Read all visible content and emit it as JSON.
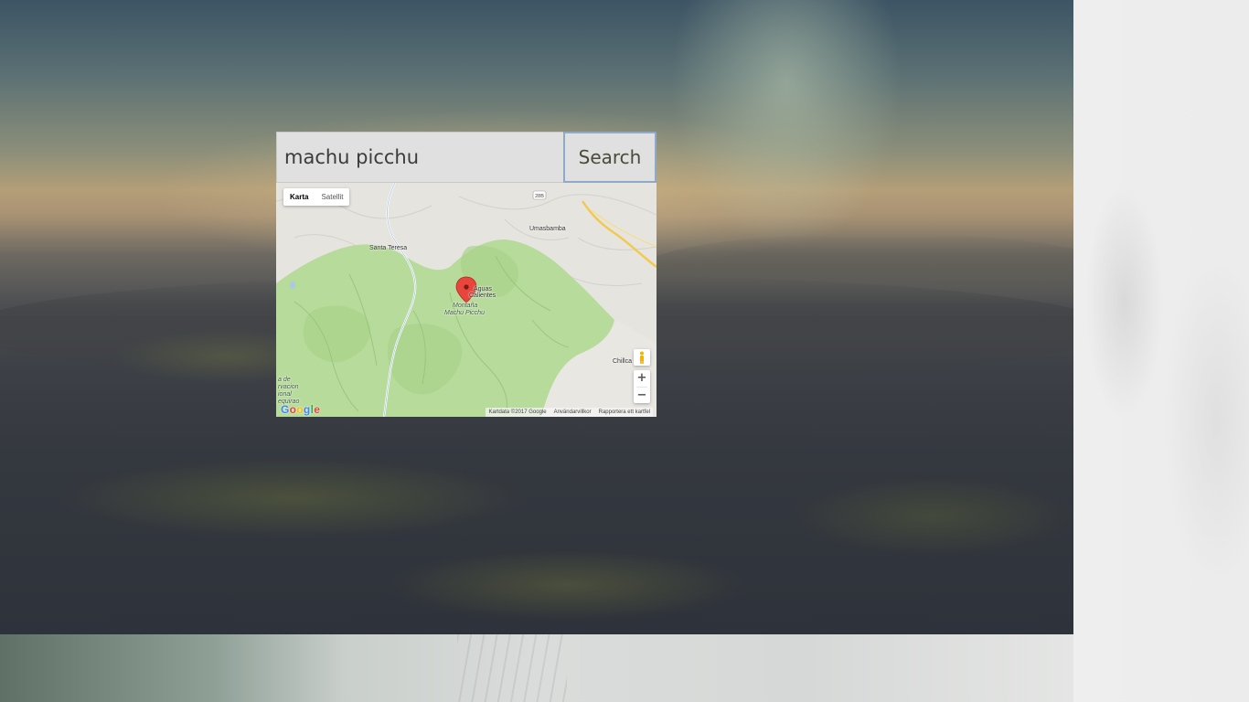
{
  "search": {
    "value": "machu picchu",
    "button_label": "Search"
  },
  "map": {
    "type_control": {
      "map_label": "Karta",
      "satellite_label": "Satellit"
    },
    "places": {
      "santa_teresa": "Santa Teresa",
      "umasbamba": "Umasbamba",
      "aguas_calientes_1": "Aguas",
      "aguas_calientes_2": "Calientes",
      "montana_1": "Montaña",
      "montana_2": "Machu Picchu",
      "chillca": "Chillca",
      "route_shield": "28B",
      "left_edge_1": "a de",
      "left_edge_2": "rvacion",
      "left_edge_3": "ional",
      "left_edge_4": "equirao"
    },
    "zoom_in": "+",
    "zoom_out": "−",
    "logo": "Google",
    "footer": {
      "map_data": "Kartdata ©2017 Google",
      "terms": "Användarvillkor",
      "report": "Rapportera ett kartfel"
    }
  },
  "colors": {
    "search_bg": "#e0e0e0",
    "button_border": "#8ea9c9",
    "park_green": "#b7db9a",
    "marker_red": "#e8453c"
  }
}
